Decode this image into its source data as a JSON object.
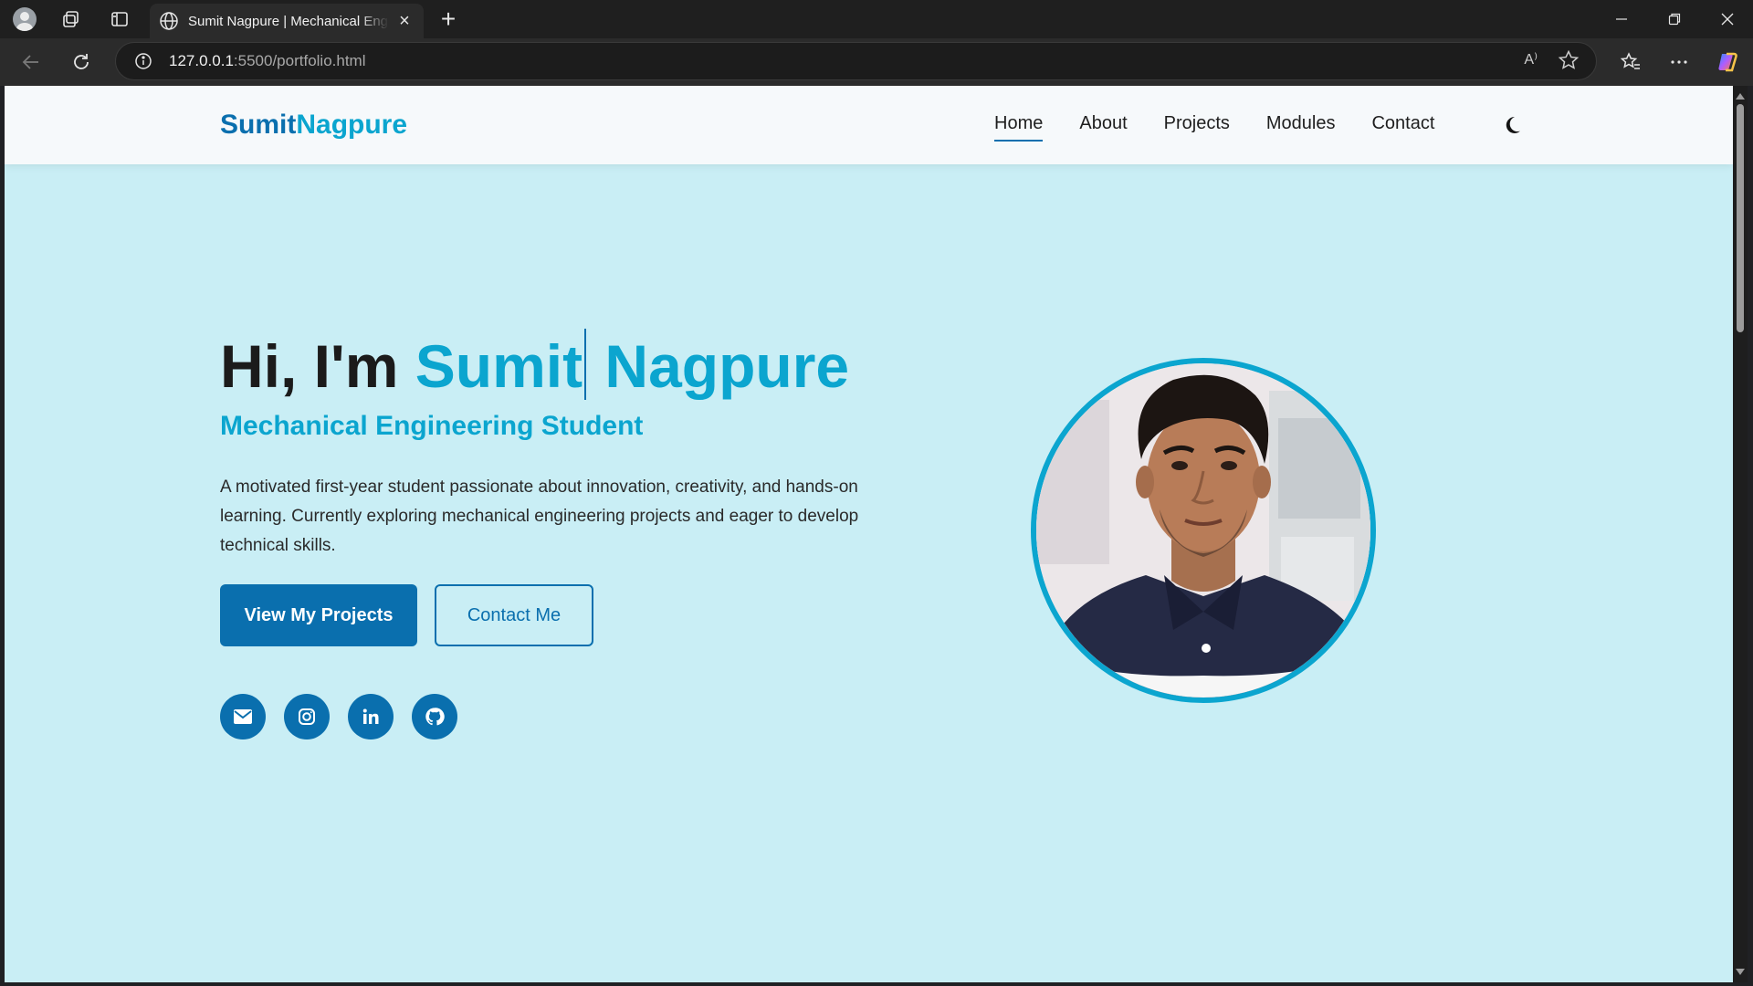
{
  "browser": {
    "tab_title": "Sumit Nagpure | Mechanical Engineering Student",
    "url_host": "127.0.0.1",
    "url_rest": ":5500/portfolio.html",
    "read_aloud_label": "A⁾",
    "window_controls": [
      "minimize",
      "restore",
      "close"
    ]
  },
  "site": {
    "logo_part1": "Sumit",
    "logo_part2": "Nagpure",
    "nav": [
      {
        "label": "Home",
        "active": true
      },
      {
        "label": "About",
        "active": false
      },
      {
        "label": "Projects",
        "active": false
      },
      {
        "label": "Modules",
        "active": false
      },
      {
        "label": "Contact",
        "active": false
      }
    ],
    "theme_icon": "moon-icon"
  },
  "hero": {
    "greeting": "Hi, I'm ",
    "name_typed": "Sumit",
    "name_rest": " Nagpure",
    "subtitle": "Mechanical Engineering Student",
    "description": "A motivated first-year student passionate about innovation, creativity, and hands-on learning. Currently exploring mechanical engineering projects and eager to develop technical skills.",
    "primary_button": "View My Projects",
    "secondary_button": "Contact Me",
    "socials": [
      "envelope-icon",
      "instagram-icon",
      "linkedin-icon",
      "github-icon"
    ],
    "avatar": "profile-photo"
  },
  "colors": {
    "brand": "#0a6fae",
    "accent": "#0ba5cf",
    "hero_bg": "#c9eef5",
    "header_bg": "#f6f9fb"
  }
}
